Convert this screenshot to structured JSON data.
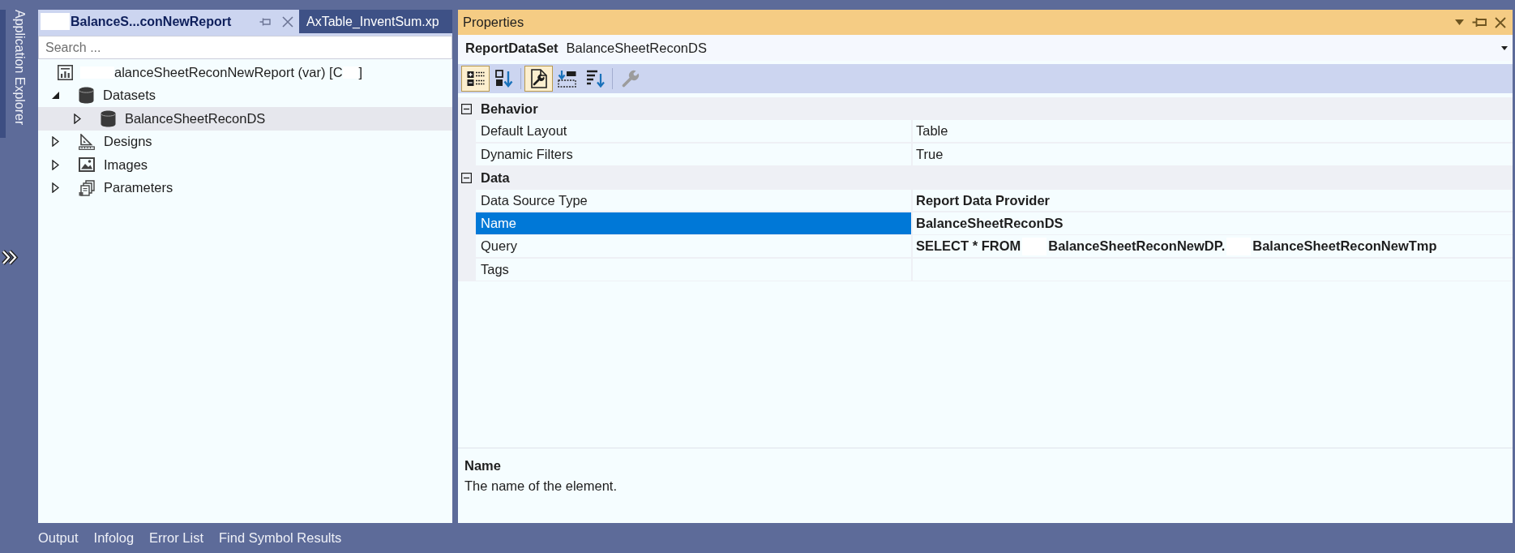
{
  "side_tabs": [
    "Application Explorer"
  ],
  "explorer": {
    "tabs": [
      {
        "label": "BalanceS...conNewReport",
        "redacted_prefix": true,
        "selected": true
      },
      {
        "label": "AxTable_InventSum.xp",
        "redacted_prefix": false,
        "selected": false
      }
    ],
    "search": {
      "placeholder": "Search ..."
    },
    "tree": [
      {
        "kind": "report",
        "segments": [
          {
            "kind": "redacted"
          },
          {
            "kind": "text",
            "text": "alanceSheetReconNewReport (var) [C"
          },
          {
            "kind": "redacted"
          },
          {
            "kind": "text",
            "text": "]"
          }
        ],
        "selected": false,
        "children": [
          {
            "kind": "datasets",
            "label": "Datasets",
            "expanded": true,
            "selected": false,
            "children": [
              {
                "kind": "dataset",
                "label": "BalanceSheetReconDS",
                "expanded": false,
                "selected": true
              }
            ]
          },
          {
            "kind": "designs",
            "label": "Designs",
            "expanded": false,
            "selected": false
          },
          {
            "kind": "images",
            "label": "Images",
            "expanded": false,
            "selected": false
          },
          {
            "kind": "parameters",
            "label": "Parameters",
            "expanded": false,
            "selected": false
          }
        ]
      }
    ]
  },
  "properties": {
    "title": "Properties",
    "object": {
      "type": "ReportDataSet",
      "name": "BalanceSheetReconDS"
    },
    "toolbar": [
      [
        {
          "kind": "categorized",
          "selected": true,
          "disabled": false
        },
        {
          "kind": "alphabetical",
          "selected": false,
          "disabled": false
        }
      ],
      [
        {
          "kind": "properties",
          "selected": true,
          "disabled": false
        },
        {
          "kind": "events",
          "selected": false,
          "disabled": false
        },
        {
          "kind": "sort",
          "selected": false,
          "disabled": false
        }
      ],
      [
        {
          "kind": "property_pages",
          "selected": false,
          "disabled": true
        }
      ]
    ],
    "categories": [
      {
        "name": "Behavior",
        "expanded": true,
        "rows": [
          {
            "name": "Default Layout",
            "value": "Table",
            "modified": false,
            "selected": false
          },
          {
            "name": "Dynamic Filters",
            "value": "True",
            "modified": false,
            "selected": false
          }
        ]
      },
      {
        "name": "Data",
        "expanded": true,
        "rows": [
          {
            "name": "Data Source Type",
            "value": "Report Data Provider",
            "modified": true,
            "selected": false
          },
          {
            "name": "Name",
            "value": "BalanceSheetReconDS",
            "modified": true,
            "selected": true
          },
          {
            "name": "Query",
            "segments": [
              {
                "kind": "text",
                "text": "SELECT * FROM"
              },
              {
                "kind": "redacted"
              },
              {
                "kind": "text",
                "text": "BalanceSheetReconNewDP."
              },
              {
                "kind": "redacted"
              },
              {
                "kind": "text",
                "text": "BalanceSheetReconNewTmp"
              }
            ],
            "modified": true,
            "selected": false
          },
          {
            "name": "Tags",
            "modified": false,
            "selected": false
          }
        ]
      }
    ],
    "description": {
      "title": "Name",
      "text": "The name of the element."
    }
  },
  "bottom_tabs": [
    "Output",
    "Infolog",
    "Error List",
    "Find Symbol Results"
  ]
}
